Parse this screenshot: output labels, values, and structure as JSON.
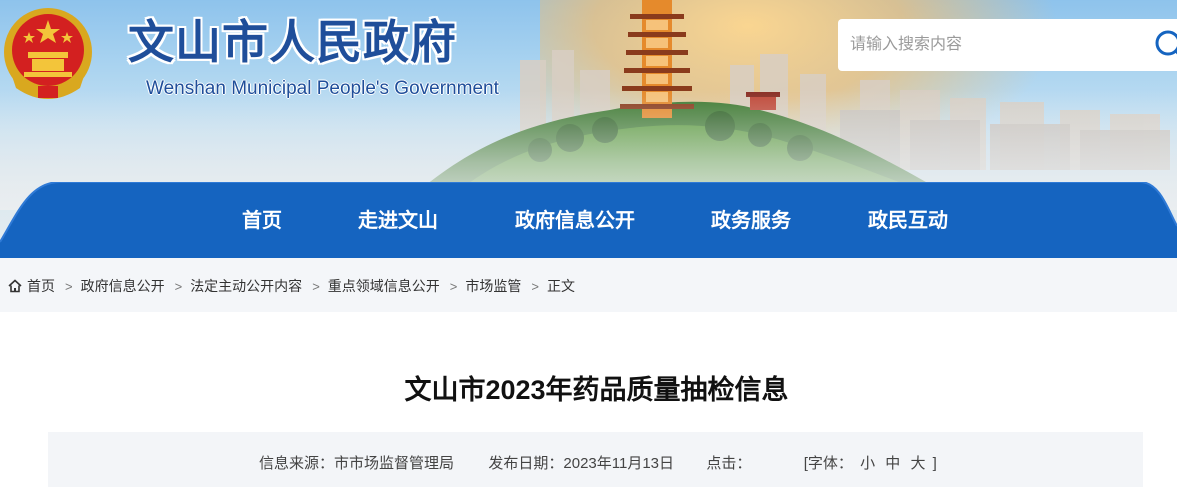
{
  "header": {
    "title_cn": "文山市人民政府",
    "title_en": "Wenshan Municipal People's Government",
    "emblem": "national-emblem"
  },
  "search": {
    "placeholder": "请输入搜索内容",
    "icon": "search-icon"
  },
  "nav": {
    "items": [
      {
        "label": "首页"
      },
      {
        "label": "走进文山"
      },
      {
        "label": "政府信息公开"
      },
      {
        "label": "政务服务"
      },
      {
        "label": "政民互动"
      }
    ]
  },
  "breadcrumb": {
    "icon": "home-icon",
    "separator": ">",
    "items": [
      "首页",
      "政府信息公开",
      "法定主动公开内容",
      "重点领域信息公开",
      "市场监管",
      "正文"
    ]
  },
  "article": {
    "title": "文山市2023年药品质量抽检信息",
    "source_label": "信息来源：",
    "source": "市市场监督管理局",
    "date_label": "发布日期：",
    "date": "2023年11月13日",
    "clicks_label": "点击：",
    "clicks": "",
    "font_open": "[字体：",
    "font_small": "小",
    "font_medium": "中",
    "font_large": "大",
    "font_close": "]"
  },
  "colors": {
    "brand_blue": "#1f4e9a",
    "nav_blue": "#1564c0",
    "breadcrumb_bg": "#f4f6f9"
  }
}
